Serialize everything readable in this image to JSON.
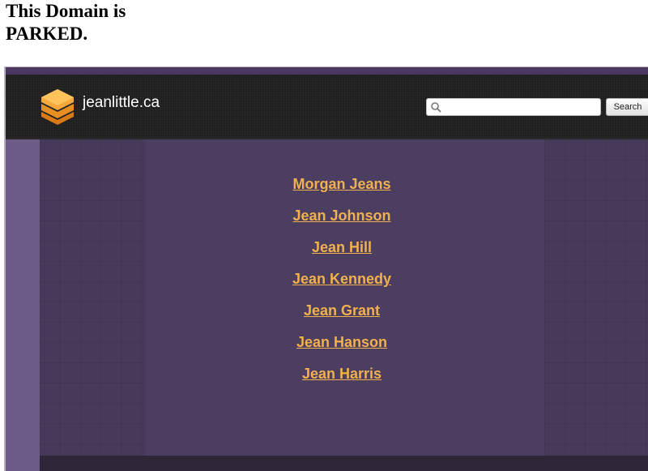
{
  "page": {
    "heading": "This Domain is PARKED."
  },
  "site": {
    "name": "jeanlittle.ca",
    "logo_icon": "stacked-layers-icon",
    "accent_color": "#f2b04e",
    "header_bg": "#1f1f1f"
  },
  "search": {
    "placeholder": "",
    "value": "",
    "button_label": "Search",
    "icon": "search-icon"
  },
  "links": [
    {
      "label": "Morgan Jeans"
    },
    {
      "label": "Jean Johnson"
    },
    {
      "label": "Jean Hill"
    },
    {
      "label": "Jean Kennedy"
    },
    {
      "label": "Jean Grant"
    },
    {
      "label": "Jean Hanson"
    },
    {
      "label": "Jean Harris"
    }
  ]
}
